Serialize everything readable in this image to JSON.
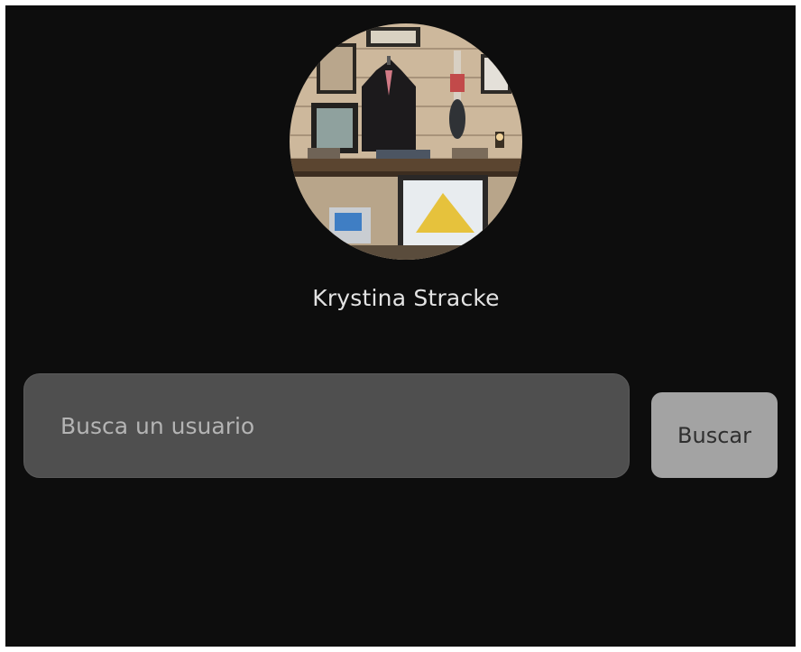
{
  "profile": {
    "name": "Krystina Stracke",
    "avatar_icon": "user-avatar-photo"
  },
  "search": {
    "placeholder": "Busca un usuario",
    "value": "",
    "button_label": "Buscar"
  },
  "colors": {
    "background": "#0d0d0d",
    "input_background": "#4f4f4f",
    "button_background": "#a3a3a3",
    "text": "#e3e3e3"
  }
}
